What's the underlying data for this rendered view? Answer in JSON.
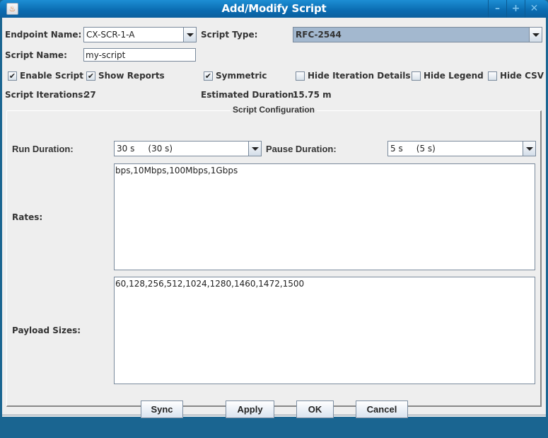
{
  "window": {
    "title": "Add/Modify Script",
    "icons": {
      "app": "java-app-icon",
      "minimize": "minimize-icon",
      "maximize": "maximize-icon",
      "close": "close-icon"
    },
    "controls": {
      "minimize": "–",
      "maximize": "+",
      "close": "✕",
      "app_glyph": "♨"
    }
  },
  "form": {
    "endpoint_name": {
      "label": "Endpoint Name:",
      "value": "CX-SCR-1-A"
    },
    "script_type": {
      "label": "Script Type:",
      "value": "RFC-2544"
    },
    "script_name": {
      "label": "Script Name:",
      "value": "my-script"
    },
    "checkboxes": [
      {
        "label": "Enable Script",
        "checked": true,
        "mark": "✔"
      },
      {
        "label": "Show Reports",
        "checked": true,
        "mark": "✔"
      },
      {
        "label": "Symmetric",
        "checked": true,
        "mark": "✔"
      },
      {
        "label": "Hide Iteration Details",
        "checked": false,
        "mark": ""
      },
      {
        "label": "Hide Legend",
        "checked": false,
        "mark": ""
      },
      {
        "label": "Hide CSV",
        "checked": false,
        "mark": ""
      }
    ],
    "script_iterations": {
      "label": "Script Iterations:",
      "value": "27"
    },
    "estimated_duration": {
      "label": "Estimated Duration:",
      "value": "15.75 m"
    }
  },
  "config": {
    "title": "Script Configuration",
    "run_duration": {
      "label": "Run Duration:",
      "value": "30 s     (30 s)"
    },
    "pause_duration": {
      "label": "Pause Duration:",
      "value": "5 s     (5 s)"
    },
    "rates": {
      "label": "Rates:",
      "value": "bps,10Mbps,100Mbps,1Gbps"
    },
    "payload_sizes": {
      "label": "Payload Sizes:",
      "value": "60,128,256,512,1024,1280,1460,1472,1500"
    }
  },
  "buttons": {
    "sync": "Sync",
    "apply": "Apply",
    "ok": "OK",
    "cancel": "Cancel"
  }
}
